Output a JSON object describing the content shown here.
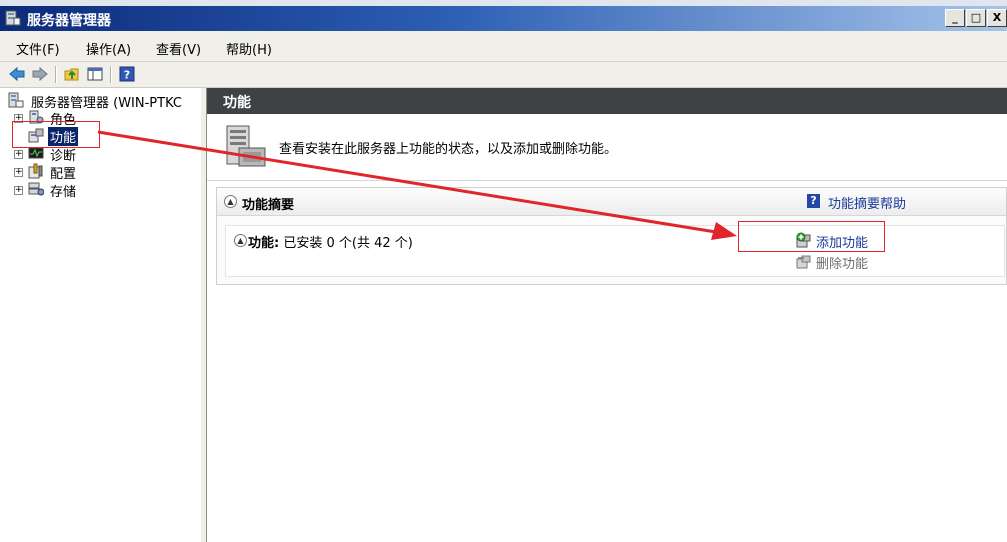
{
  "window": {
    "title": "服务器管理器",
    "minimize_glyph": "_",
    "maximize_glyph": "□",
    "close_glyph": "X"
  },
  "menubar": {
    "items": [
      {
        "label": "文件(F)"
      },
      {
        "label": "操作(A)"
      },
      {
        "label": "查看(V)"
      },
      {
        "label": "帮助(H)"
      }
    ]
  },
  "toolbar": {
    "icons": [
      "back-icon",
      "forward-icon",
      "up-folder-icon",
      "show-hide-tree-icon",
      "help-icon"
    ]
  },
  "tree": {
    "root": {
      "label": "服务器管理器 (WIN-PTKC",
      "icon": "server-manager-icon"
    },
    "items": [
      {
        "label": "角色",
        "icon": "roles-icon",
        "expander": "+"
      },
      {
        "label": "功能",
        "icon": "features-icon",
        "expander": ""
      },
      {
        "label": "诊断",
        "icon": "diagnostics-icon",
        "expander": "+"
      },
      {
        "label": "配置",
        "icon": "configuration-icon",
        "expander": "+"
      },
      {
        "label": "存储",
        "icon": "storage-icon",
        "expander": "+"
      }
    ]
  },
  "main": {
    "header": "功能",
    "description": "查看安装在此服务器上功能的状态，以及添加或删除功能。",
    "summary": {
      "title": "功能摘要",
      "help_label": "功能摘要帮助",
      "features_label": "功能:",
      "features_status": "已安装 0 个(共 42 个)",
      "actions": [
        {
          "label": "添加功能",
          "icon": "add-feature-icon",
          "enabled": true
        },
        {
          "label": "删除功能",
          "icon": "remove-feature-icon",
          "enabled": false
        }
      ]
    }
  },
  "colors": {
    "header_bg": "#3f4245",
    "link": "#1a3a9a",
    "annotation": "#e0262b",
    "selection": "#0a246a"
  }
}
